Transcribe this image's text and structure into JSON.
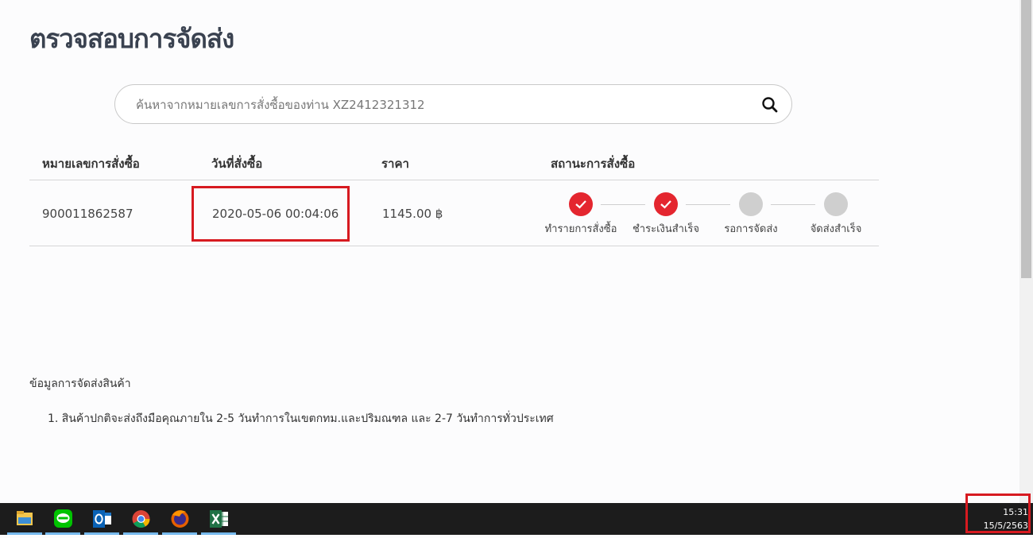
{
  "page": {
    "title": "ตรวจสอบการจัดส่ง"
  },
  "search": {
    "placeholder": "ค้นหาจากหมายเลขการสั่งซื้อของท่าน XZ2412321312",
    "value": ""
  },
  "table": {
    "headers": [
      "หมายเลขการสั่งซื้อ",
      "วันที่สั่งซื้อ",
      "ราคา",
      "สถานะการสั่งซื้อ"
    ],
    "rows": [
      {
        "order_no": "900011862587",
        "date": "2020-05-06 00:04:06",
        "price": "1145.00 ฿",
        "steps": [
          {
            "label": "ทำรายการสั่งซื้อ",
            "done": true
          },
          {
            "label": "ชำระเงินสำเร็จ",
            "done": true
          },
          {
            "label": "รอการจัดส่ง",
            "done": false
          },
          {
            "label": "จัดส่งสำเร็จ",
            "done": false
          }
        ]
      }
    ]
  },
  "info": {
    "heading": "ข้อมูลการจัดส่งสินค้า",
    "items": [
      "1. สินค้าปกติจะส่งถึงมือคุณภายใน 2-5 วันทำการในเขตกทม.และปริมณฑล และ 2-7 วันทำการทั่วประเทศ"
    ]
  },
  "taskbar": {
    "apps": [
      "file-explorer-icon",
      "line-icon",
      "outlook-icon",
      "chrome-icon",
      "firefox-icon",
      "excel-icon"
    ],
    "clock": {
      "time": "15:31",
      "date": "15/5/2563"
    }
  },
  "colors": {
    "accent": "#e4262f",
    "pending": "#cfcfcf",
    "highlight": "#d71a20",
    "taskbar": "#1c1c1c"
  }
}
